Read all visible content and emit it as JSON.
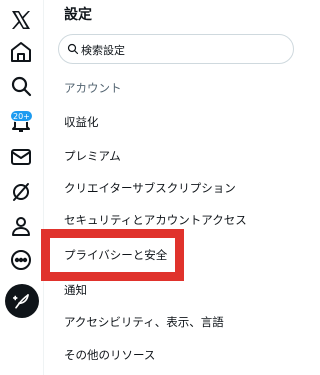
{
  "header": {
    "title": "設定"
  },
  "search": {
    "placeholder": "検索設定"
  },
  "nav": {
    "notifications_badge": "20+",
    "icons": [
      "x-logo-icon",
      "home-icon",
      "search-icon",
      "notifications-icon",
      "messages-icon",
      "grok-icon",
      "profile-icon",
      "more-icon",
      "post-icon"
    ]
  },
  "menu": {
    "items": [
      "アカウント",
      "収益化",
      "プレミアム",
      "クリエイターサブスクリプション",
      "セキュリティとアカウントアクセス",
      "プライバシーと安全",
      "通知",
      "アクセシビリティ、表示、言語",
      "その他のリソース"
    ],
    "active_index": 0,
    "highlighted_index": 5
  },
  "colors": {
    "highlight": "#e0322c",
    "accent": "#1d9bf0",
    "text": "#0f1419",
    "muted": "#536471"
  }
}
